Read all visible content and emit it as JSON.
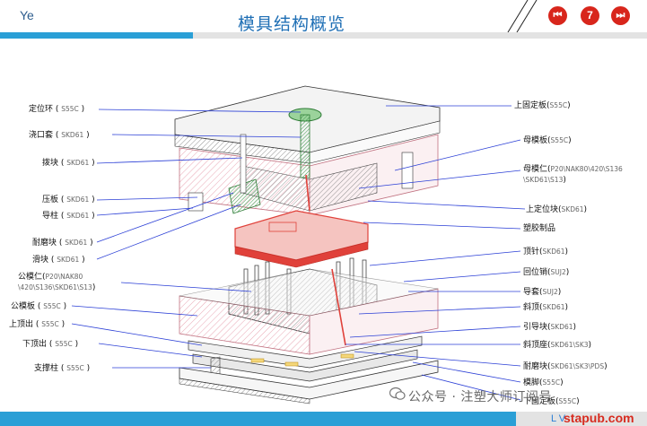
{
  "header": {
    "brand": "Ye",
    "title": "模具结构概览",
    "page_number": "7"
  },
  "labels_left": [
    {
      "name": "定位环",
      "sub": "S55C"
    },
    {
      "name": "浇口套",
      "sub": "SKD61"
    },
    {
      "name": "拨块",
      "sub": "SKD61"
    },
    {
      "name": "压板",
      "sub": "SKD61"
    },
    {
      "name": "导柱",
      "sub": "SKD61"
    },
    {
      "name": "耐磨块",
      "sub": "SKD61"
    },
    {
      "name": "滑块",
      "sub": "SKD61"
    },
    {
      "name": "公模仁",
      "sub": "P20\\NAK80",
      "sub2": "\\420\\S136\\SKD61\\S13"
    },
    {
      "name": "公模板",
      "sub": "S55C"
    },
    {
      "name": "上顶出",
      "sub": "S55C"
    },
    {
      "name": "下顶出",
      "sub": "S55C"
    },
    {
      "name": "支撑柱",
      "sub": "S55C"
    }
  ],
  "labels_right": [
    {
      "name": "上固定板",
      "sub": "S55C"
    },
    {
      "name": "母模板",
      "sub": "S55C"
    },
    {
      "name": "母模仁",
      "sub": "P20\\NAK80\\420\\S136",
      "sub2": "\\SKD61\\S13"
    },
    {
      "name": "上定位块",
      "sub": "SKD61"
    },
    {
      "name": "塑胶制品",
      "sub": ""
    },
    {
      "name": "顶针",
      "sub": "SKD61"
    },
    {
      "name": "回位销",
      "sub": "SUJ2"
    },
    {
      "name": "导套",
      "sub": "SUJ2"
    },
    {
      "name": "斜顶",
      "sub": "SKD61"
    },
    {
      "name": "引导块",
      "sub": "SKD61"
    },
    {
      "name": "斜顶座",
      "sub": "SKD61\\SK3"
    },
    {
      "name": "耐磨块",
      "sub": "SKD61\\SK3\\PDS"
    },
    {
      "name": "模脚",
      "sub": "S55C"
    },
    {
      "name": "下固定板",
      "sub": "S55C"
    }
  ],
  "footer": {
    "watermark": "公众号 · 注塑大师订阅号",
    "site": "stapub.com",
    "lv": "L V"
  },
  "colors": {
    "accent_blue": "#2a9fd6",
    "title_blue": "#1f6fb5",
    "nav_red": "#d8261c",
    "line_blue": "#2b3fd6",
    "hatch_pink": "#e9a6b4",
    "part_red": "#e0413a"
  }
}
